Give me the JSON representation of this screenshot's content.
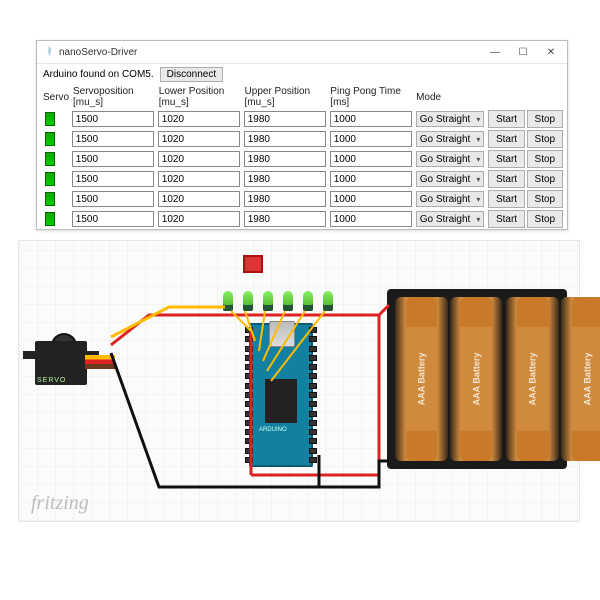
{
  "window": {
    "title": "nanoServo-Driver",
    "status": "Arduino found on COM5.",
    "disconnect": "Disconnect",
    "min_icon": "—",
    "max_icon": "☐",
    "close_icon": "✕"
  },
  "headers": {
    "servo": "Servo",
    "pos": "Servoposition [mu_s]",
    "low": "Lower Position [mu_s]",
    "up": "Upper Position [mu_s]",
    "ping": "Ping Pong Time [ms]",
    "mode": "Mode",
    "start": "Start",
    "stop": "Stop"
  },
  "mode_option": "Go Straight",
  "rows": [
    {
      "pos": "1500",
      "low": "1020",
      "up": "1980",
      "ping": "1000"
    },
    {
      "pos": "1500",
      "low": "1020",
      "up": "1980",
      "ping": "1000"
    },
    {
      "pos": "1500",
      "low": "1020",
      "up": "1980",
      "ping": "1000"
    },
    {
      "pos": "1500",
      "low": "1020",
      "up": "1980",
      "ping": "1000"
    },
    {
      "pos": "1500",
      "low": "1020",
      "up": "1980",
      "ping": "1000"
    },
    {
      "pos": "1500",
      "low": "1020",
      "up": "1980",
      "ping": "1000"
    }
  ],
  "diagram": {
    "watermark": "fritzing",
    "servo_label": "SERVO",
    "nano_label": "ARDUINO",
    "battery_label": "AAA Battery"
  }
}
